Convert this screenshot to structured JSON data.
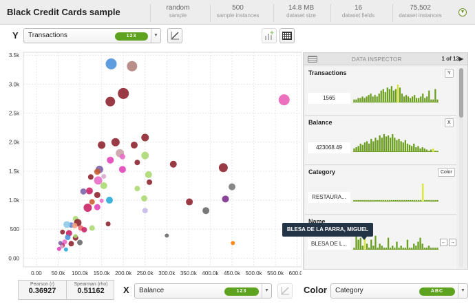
{
  "app": {
    "title": "Black Credit Cards sample"
  },
  "stats": [
    {
      "value": "random",
      "label": "sample"
    },
    {
      "value": "500",
      "label": "sample instances"
    },
    {
      "value": "14.8 MB",
      "label": "dataset size"
    },
    {
      "value": "16",
      "label": "dataset fields"
    },
    {
      "value": "75,502",
      "label": "dataset instances"
    }
  ],
  "y_axis": {
    "letter": "Y",
    "field": "Transactions",
    "type_badge": "123"
  },
  "x_axis": {
    "letter": "X",
    "field": "Balance",
    "type_badge": "123"
  },
  "color": {
    "label": "Color",
    "field": "Category",
    "type_badge": "ABC"
  },
  "correlation": {
    "pearson_label": "Pearson (r)",
    "pearson_value": "0.36927",
    "spearman_label": "Spearman (rho)",
    "spearman_value": "0.51162"
  },
  "inspector": {
    "title": "DATA INSPECTOR",
    "page": "1 of 13▶",
    "fields": [
      {
        "name": "Transactions",
        "button": "Y",
        "value": "1565"
      },
      {
        "name": "Balance",
        "button": "X",
        "value": "423068.49"
      },
      {
        "name": "Category",
        "button": "Color",
        "value": "RESTAURA..."
      },
      {
        "name": "Name",
        "button": "",
        "value": "BLESA DE L..."
      }
    ],
    "nav_prev": "←",
    "nav_next": "→"
  },
  "tooltip": {
    "text": "BLESA DE LA PARRA, MIGUEL"
  },
  "icons": {
    "header_menu": "chevron-down-circle-icon",
    "y_regression": "regression-line-icon",
    "x_regression": "regression-line-icon",
    "add_chart": "add-chart-icon",
    "grid_view": "grid-view-icon",
    "inspector_menu": "list-icon"
  },
  "chart_data": {
    "type": "scatter",
    "xlabel": "",
    "ylabel": "",
    "xlim": [
      -30000,
      610000
    ],
    "ylim": [
      -150,
      3550
    ],
    "x_ticks": [
      "0.00",
      "50.0k",
      "100.0k",
      "150.0k",
      "200.0k",
      "250.0k",
      "300.0k",
      "350.0k",
      "400.0k",
      "450.0k",
      "500.0k",
      "550.0k",
      "600.0k"
    ],
    "y_ticks": [
      "0.00",
      "500",
      "1.0k",
      "1.5k",
      "2.0k",
      "2.5k",
      "3.0k",
      "3.5k"
    ],
    "grid": true,
    "points": [
      {
        "x": 172000,
        "y": 3350,
        "size": 16,
        "color": "#4a90d9"
      },
      {
        "x": 220000,
        "y": 3310,
        "size": 15,
        "color": "#b07f7a"
      },
      {
        "x": 200000,
        "y": 2840,
        "size": 16,
        "color": "#8c1f2a"
      },
      {
        "x": 170000,
        "y": 2700,
        "size": 14,
        "color": "#8c1f2a"
      },
      {
        "x": 570000,
        "y": 2730,
        "size": 16,
        "color": "#e85cb4"
      },
      {
        "x": 250000,
        "y": 2080,
        "size": 11,
        "color": "#8c1f2a"
      },
      {
        "x": 182000,
        "y": 2000,
        "size": 12,
        "color": "#8c1f2a"
      },
      {
        "x": 150000,
        "y": 1950,
        "size": 11,
        "color": "#8c1f2a"
      },
      {
        "x": 225000,
        "y": 1950,
        "size": 10,
        "color": "#8c1f2a"
      },
      {
        "x": 192000,
        "y": 1810,
        "size": 12,
        "color": "#c7a0a4"
      },
      {
        "x": 250000,
        "y": 1770,
        "size": 11,
        "color": "#a8d86e"
      },
      {
        "x": 198000,
        "y": 1750,
        "size": 8,
        "color": "#e868c8"
      },
      {
        "x": 170000,
        "y": 1690,
        "size": 10,
        "color": "#e33fb8"
      },
      {
        "x": 315000,
        "y": 1620,
        "size": 10,
        "color": "#8c1f2a"
      },
      {
        "x": 232000,
        "y": 1650,
        "size": 8,
        "color": "#8c1f2a"
      },
      {
        "x": 145000,
        "y": 1530,
        "size": 11,
        "color": "#7b5ea7"
      },
      {
        "x": 198000,
        "y": 1530,
        "size": 10,
        "color": "#e33fb8"
      },
      {
        "x": 430000,
        "y": 1560,
        "size": 13,
        "color": "#8c1f2a"
      },
      {
        "x": 140000,
        "y": 1490,
        "size": 9,
        "color": "#c85a2e"
      },
      {
        "x": 125000,
        "y": 1400,
        "size": 8,
        "color": "#8c1f2a"
      },
      {
        "x": 155000,
        "y": 1410,
        "size": 7,
        "color": "#d4a8c8"
      },
      {
        "x": 258000,
        "y": 1440,
        "size": 10,
        "color": "#a8d86e"
      },
      {
        "x": 142000,
        "y": 1340,
        "size": 12,
        "color": "#e868c8"
      },
      {
        "x": 260000,
        "y": 1310,
        "size": 8,
        "color": "#8c1f2a"
      },
      {
        "x": 155000,
        "y": 1250,
        "size": 10,
        "color": "#a8d86e"
      },
      {
        "x": 122000,
        "y": 1160,
        "size": 10,
        "color": "#c81e62"
      },
      {
        "x": 108000,
        "y": 1150,
        "size": 9,
        "color": "#7b5ea7"
      },
      {
        "x": 140000,
        "y": 1090,
        "size": 9,
        "color": "#8c1f2a"
      },
      {
        "x": 232000,
        "y": 1200,
        "size": 8,
        "color": "#a8d86e"
      },
      {
        "x": 450000,
        "y": 1230,
        "size": 10,
        "color": "#777777"
      },
      {
        "x": 168000,
        "y": 1000,
        "size": 10,
        "color": "#22a8d8"
      },
      {
        "x": 248000,
        "y": 1030,
        "size": 9,
        "color": "#a8d86e"
      },
      {
        "x": 352000,
        "y": 970,
        "size": 10,
        "color": "#8c1f2a"
      },
      {
        "x": 435000,
        "y": 1020,
        "size": 10,
        "color": "#7b2a8a"
      },
      {
        "x": 128000,
        "y": 970,
        "size": 8,
        "color": "#c85a2e"
      },
      {
        "x": 150000,
        "y": 990,
        "size": 6,
        "color": "#e868c8"
      },
      {
        "x": 118000,
        "y": 870,
        "size": 12,
        "color": "#c81e62"
      },
      {
        "x": 140000,
        "y": 880,
        "size": 9,
        "color": "#e33fb8"
      },
      {
        "x": 250000,
        "y": 820,
        "size": 8,
        "color": "#c4b8e8"
      },
      {
        "x": 390000,
        "y": 820,
        "size": 10,
        "color": "#666666"
      },
      {
        "x": 90000,
        "y": 680,
        "size": 8,
        "color": "#a8d86e"
      },
      {
        "x": 95000,
        "y": 610,
        "size": 11,
        "color": "#8c1f2a"
      },
      {
        "x": 80000,
        "y": 570,
        "size": 8,
        "color": "#5a7fd4"
      },
      {
        "x": 70000,
        "y": 580,
        "size": 10,
        "color": "#8cc8e8"
      },
      {
        "x": 102000,
        "y": 520,
        "size": 8,
        "color": "#e86a6a"
      },
      {
        "x": 88000,
        "y": 560,
        "size": 8,
        "color": "#f5a080"
      },
      {
        "x": 128000,
        "y": 520,
        "size": 8,
        "color": "#a8d86e"
      },
      {
        "x": 165000,
        "y": 590,
        "size": 7,
        "color": "#8c1f2a"
      },
      {
        "x": 60000,
        "y": 450,
        "size": 7,
        "color": "#8c1f2a"
      },
      {
        "x": 75000,
        "y": 430,
        "size": 9,
        "color": "#c81e62"
      },
      {
        "x": 110000,
        "y": 490,
        "size": 8,
        "color": "#c81e62"
      },
      {
        "x": 72000,
        "y": 360,
        "size": 8,
        "color": "#4a90d9"
      },
      {
        "x": 90000,
        "y": 350,
        "size": 8,
        "color": "#8c1f2a"
      },
      {
        "x": 300000,
        "y": 390,
        "size": 6,
        "color": "#666666"
      },
      {
        "x": 100000,
        "y": 270,
        "size": 8,
        "color": "#666666"
      },
      {
        "x": 80000,
        "y": 250,
        "size": 8,
        "color": "#8c1f2a"
      },
      {
        "x": 65000,
        "y": 280,
        "size": 7,
        "color": "#e868c8"
      },
      {
        "x": 60000,
        "y": 220,
        "size": 7,
        "color": "#c81e62"
      },
      {
        "x": 55000,
        "y": 260,
        "size": 6,
        "color": "#7b5ea7"
      },
      {
        "x": 58000,
        "y": 200,
        "size": 6,
        "color": "#d4a8c8"
      },
      {
        "x": 68000,
        "y": 150,
        "size": 6,
        "color": "#22a8d8"
      },
      {
        "x": 52000,
        "y": 160,
        "size": 6,
        "color": "#e33fb8"
      },
      {
        "x": 452000,
        "y": 260,
        "size": 6,
        "color": "#ff7a00"
      },
      {
        "x": 90000,
        "y": 380,
        "size": 6,
        "color": "#a8d86e"
      }
    ]
  },
  "histograms": {
    "transactions": [
      2,
      2,
      3,
      3,
      4,
      3,
      4,
      5,
      6,
      4,
      5,
      4,
      6,
      8,
      9,
      7,
      10,
      9,
      11,
      8,
      9,
      12,
      10,
      6,
      4,
      5,
      4,
      3,
      4,
      5,
      3,
      3,
      4,
      6,
      3,
      4,
      8,
      2,
      2,
      9,
      2
    ],
    "balance": [
      3,
      4,
      5,
      7,
      6,
      8,
      9,
      7,
      11,
      9,
      12,
      10,
      14,
      12,
      15,
      13,
      14,
      12,
      15,
      12,
      10,
      11,
      9,
      8,
      10,
      7,
      6,
      5,
      7,
      4,
      5,
      3,
      4,
      3,
      2,
      1,
      2,
      3,
      1,
      1
    ],
    "category": [
      1,
      1,
      1,
      1,
      1,
      1,
      1,
      1,
      1,
      1,
      1,
      1,
      1,
      1,
      1,
      1,
      1,
      1,
      1,
      1,
      1,
      1,
      1,
      1,
      1,
      1,
      1,
      1,
      1,
      1,
      1,
      1,
      1,
      12,
      1,
      1,
      1,
      1,
      1,
      1,
      1
    ],
    "name": [
      1,
      8,
      5,
      6,
      2,
      9,
      3,
      1,
      5,
      2,
      7,
      1,
      3,
      2,
      1,
      1,
      6,
      1,
      2,
      1,
      4,
      1,
      2,
      1,
      1,
      5,
      1,
      1,
      3,
      2,
      4,
      6,
      3,
      1,
      1,
      2,
      1,
      1,
      1,
      1
    ]
  },
  "histogram_highlight": {
    "transactions": 21,
    "balance": 37,
    "category": 33,
    "name": 5
  }
}
